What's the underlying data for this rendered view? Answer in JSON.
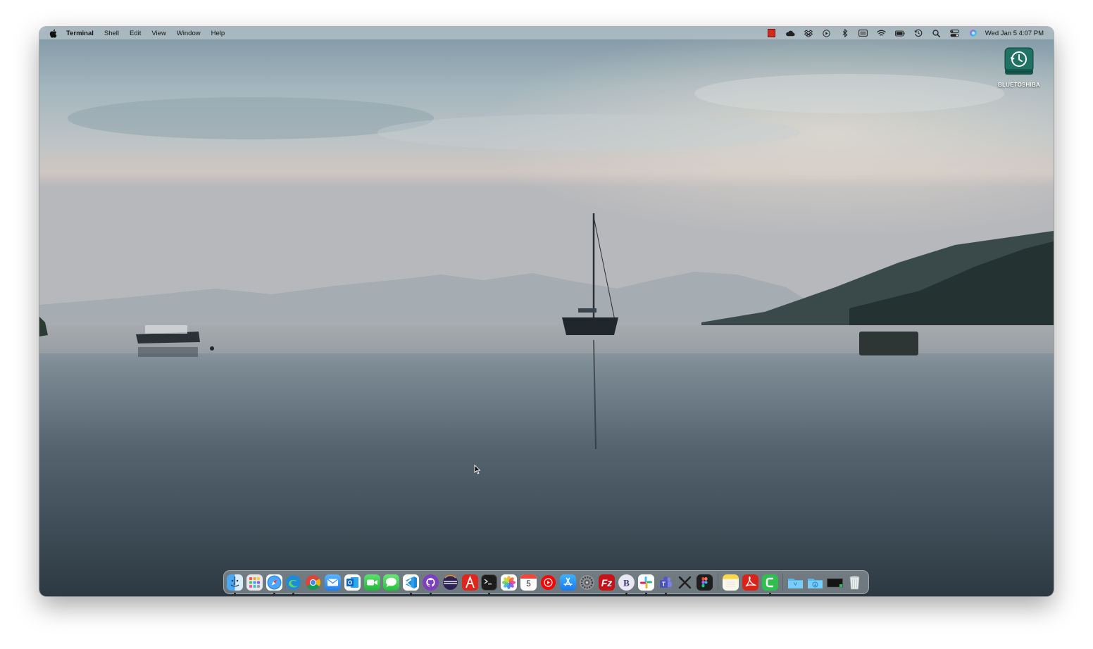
{
  "menubar": {
    "app_name": "Terminal",
    "menus": [
      "Shell",
      "Edit",
      "View",
      "Window",
      "Help"
    ],
    "status_icons": [
      "record-icon",
      "cloud-icon",
      "dropbox-icon",
      "play-icon",
      "bluetooth-icon",
      "keyboard-icon",
      "wifi-icon",
      "battery-icon",
      "time-machine-icon",
      "spotlight-icon",
      "control-center-icon",
      "siri-icon"
    ],
    "clock": "Wed Jan 5  4:07 PM"
  },
  "desktop": {
    "drive_label": "BLUETOSHIBA"
  },
  "dock": {
    "apps": [
      {
        "name": "finder",
        "running": true
      },
      {
        "name": "launchpad",
        "running": false
      },
      {
        "name": "safari",
        "running": true
      },
      {
        "name": "edge",
        "running": true
      },
      {
        "name": "chrome",
        "running": false
      },
      {
        "name": "mail",
        "running": false
      },
      {
        "name": "outlook",
        "running": false
      },
      {
        "name": "facetime",
        "running": false
      },
      {
        "name": "messages",
        "running": false
      },
      {
        "name": "vscode",
        "running": true
      },
      {
        "name": "github-desktop",
        "running": true
      },
      {
        "name": "eclipse",
        "running": false
      },
      {
        "name": "acrobat-a",
        "running": false
      },
      {
        "name": "terminal",
        "running": true
      },
      {
        "name": "photos",
        "running": false
      },
      {
        "name": "calendar",
        "running": false,
        "text": "5"
      },
      {
        "name": "youtube-music",
        "running": false
      },
      {
        "name": "app-store",
        "running": false
      },
      {
        "name": "system-preferences",
        "running": false
      },
      {
        "name": "filezilla",
        "running": false
      },
      {
        "name": "bbedit",
        "running": true
      },
      {
        "name": "slack",
        "running": true
      },
      {
        "name": "teams",
        "running": true
      },
      {
        "name": "xcode-tools",
        "running": false
      },
      {
        "name": "figma",
        "running": false
      }
    ],
    "apps_right": [
      {
        "name": "notes",
        "running": false
      },
      {
        "name": "acrobat-reader",
        "running": false
      },
      {
        "name": "camtasia",
        "running": true
      }
    ],
    "folders": [
      "applications-folder",
      "downloads-folder",
      "terminal-window",
      "trash"
    ]
  },
  "colors": {
    "menubar_text": "#141414",
    "drive_green": "#1e6f63"
  }
}
